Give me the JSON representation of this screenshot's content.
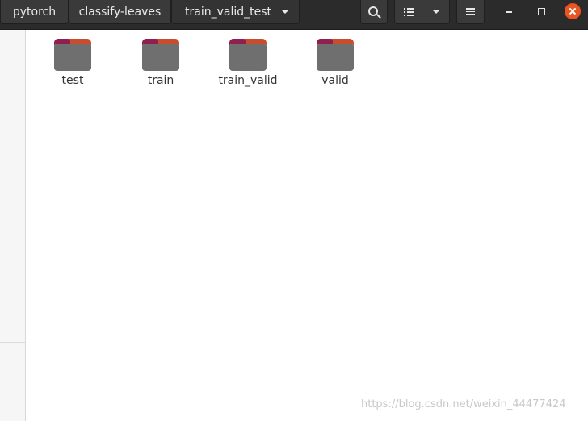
{
  "breadcrumbs": [
    {
      "label": "pytorch"
    },
    {
      "label": "classify-leaves"
    },
    {
      "label": "train_valid_test"
    }
  ],
  "toolbar": {
    "search_icon": "search-icon",
    "view_icon": "list-view-icon",
    "view_dropdown_icon": "chevron-down-icon",
    "menu_icon": "hamburger-menu-icon"
  },
  "window_controls": {
    "minimize_icon": "minimize-icon",
    "maximize_icon": "maximize-icon",
    "close_icon": "close-icon",
    "close_color": "#e95420"
  },
  "files": [
    {
      "name": "test",
      "type": "folder"
    },
    {
      "name": "train",
      "type": "folder"
    },
    {
      "name": "train_valid",
      "type": "folder"
    },
    {
      "name": "valid",
      "type": "folder"
    }
  ],
  "folder_colors": {
    "tab_dark": "#8f1f4f",
    "tab_light": "#c84d2f",
    "body": "#6f6f6f"
  },
  "watermark": "https://blog.csdn.net/weixin_44477424"
}
